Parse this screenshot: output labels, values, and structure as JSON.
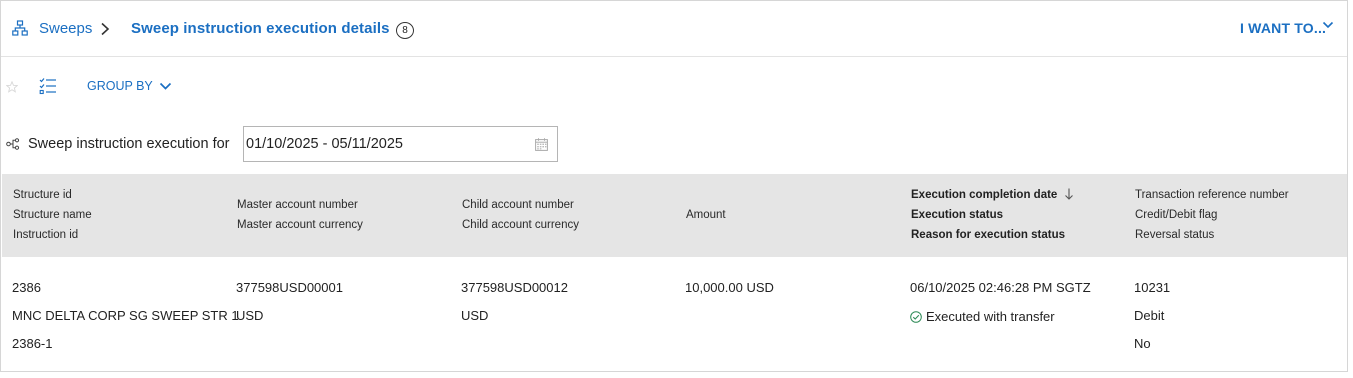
{
  "header": {
    "breadcrumb_root": "Sweeps",
    "title": "Sweep instruction execution details",
    "count": "8",
    "i_want_to": "I WANT TO..."
  },
  "toolbar": {
    "group_by": "GROUP BY"
  },
  "filter": {
    "label": "Sweep instruction execution for",
    "date_range": "01/10/2025 - 05/11/2025"
  },
  "table": {
    "columns": [
      {
        "lines": [
          "Structure id",
          "Structure name",
          "Instruction id"
        ]
      },
      {
        "lines": [
          "Master account number",
          "Master account currency"
        ]
      },
      {
        "lines": [
          "Child account number",
          "Child account currency"
        ]
      },
      {
        "lines": [
          "Amount"
        ]
      },
      {
        "lines": [
          "Execution completion date",
          "Execution status",
          "Reason for execution status"
        ],
        "sorted": "descending"
      },
      {
        "lines": [
          "Transaction reference number",
          "Credit/Debit flag",
          "Reversal status"
        ]
      }
    ],
    "rows": [
      {
        "structure_id": "2386",
        "structure_name": "MNC DELTA CORP SG SWEEP STR 1",
        "instruction_id": "2386-1",
        "master_account_number": "377598USD00001",
        "master_account_currency": "USD",
        "child_account_number": "377598USD00012",
        "child_account_currency": "USD",
        "amount": "10,000.00 USD",
        "execution_completion_date": "06/10/2025 02:46:28 PM SGTZ",
        "execution_status": "Executed with transfer",
        "transaction_reference_number": "10231",
        "credit_debit_flag": "Debit",
        "reversal_status": "No"
      }
    ]
  },
  "colors": {
    "link_blue": "#1b6fc2",
    "header_bg": "#e5e5e5",
    "success_green": "#2e8b57"
  }
}
